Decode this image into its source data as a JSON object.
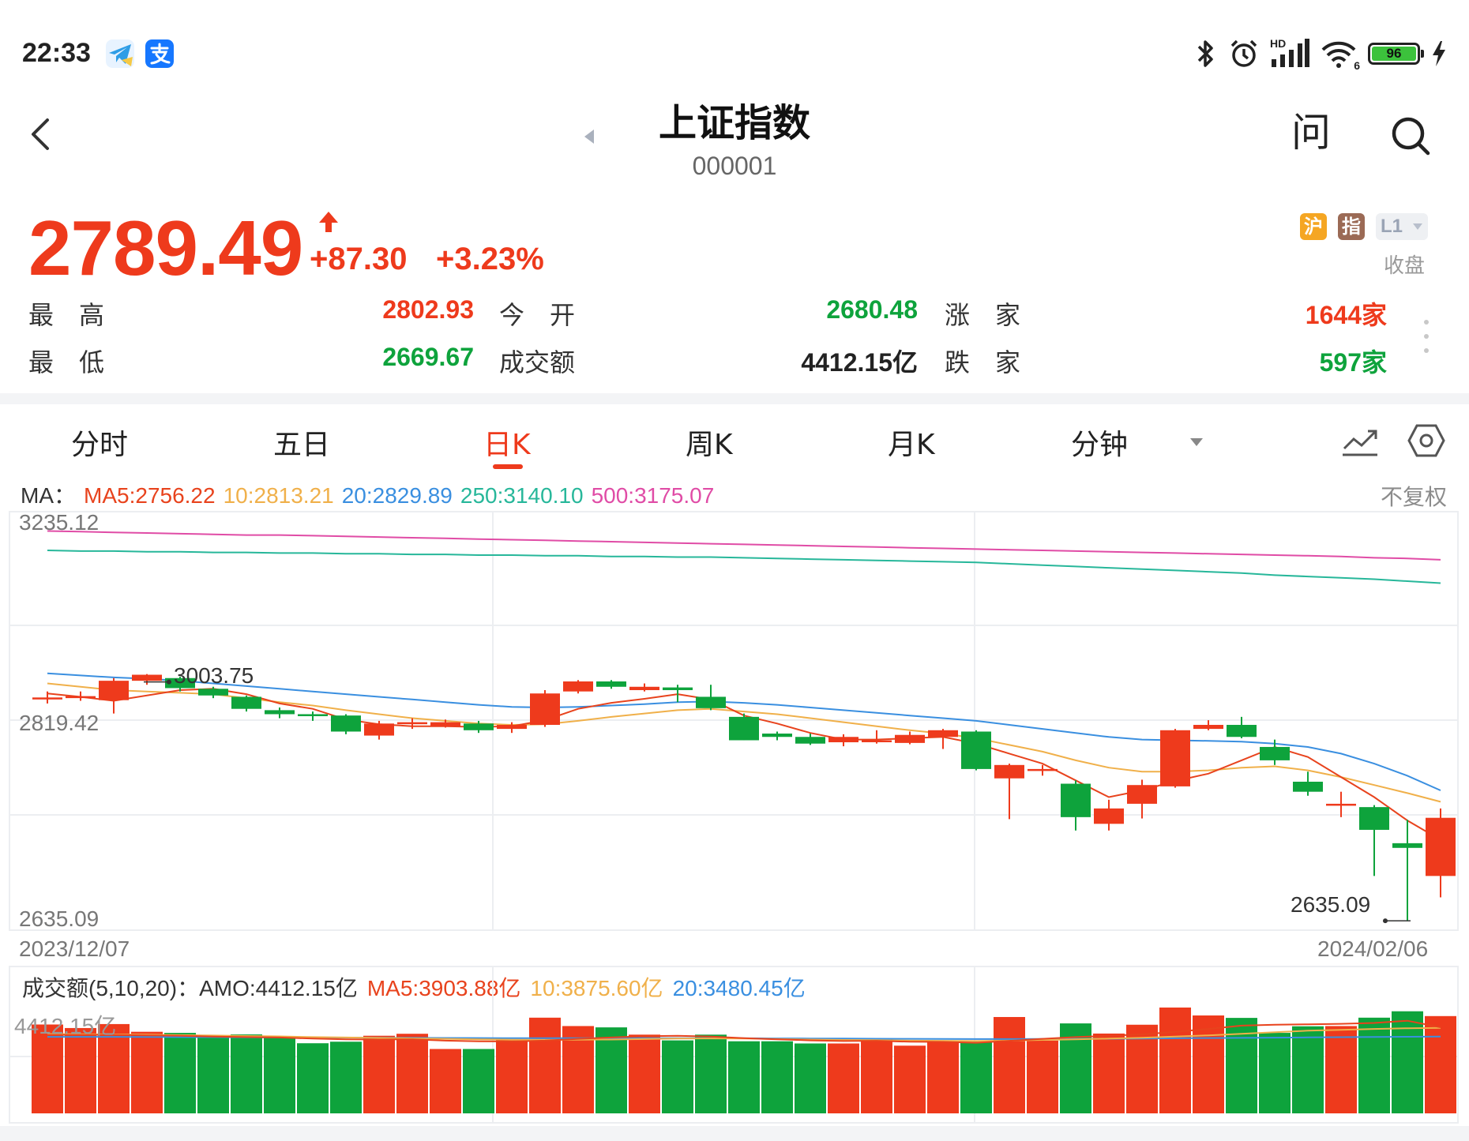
{
  "status_bar": {
    "time": "22:33",
    "network": "HD",
    "wifi_sub": "6",
    "battery": "96"
  },
  "header": {
    "title": "上证指数",
    "code": "000001",
    "ask_label": "问"
  },
  "quote": {
    "price": "2789.49",
    "change": "+87.30",
    "change_pct": "+3.23%",
    "badges": [
      "沪",
      "指",
      "L1"
    ],
    "status": "收盘",
    "colors": {
      "up": "#ee3a1c",
      "down": "#0ea33c"
    }
  },
  "stats": {
    "high_label": "最　高",
    "high": "2802.93",
    "open_label": "今　开",
    "open": "2680.48",
    "advance_label": "涨　家",
    "advance": "1644家",
    "low_label": "最　低",
    "low": "2669.67",
    "turnover_label": "成交额",
    "turnover": "4412.15亿",
    "decline_label": "跌　家",
    "decline": "597家"
  },
  "tabs": [
    {
      "label": "分时",
      "active": false
    },
    {
      "label": "五日",
      "active": false
    },
    {
      "label": "日K",
      "active": true
    },
    {
      "label": "周K",
      "active": false
    },
    {
      "label": "月K",
      "active": false
    },
    {
      "label": "分钟",
      "active": false
    }
  ],
  "ma_legend": {
    "prefix": "MA：",
    "ma5": "MA5:2756.22",
    "ma10": "10:2813.21",
    "ma20": "20:2829.89",
    "ma250": "250:3140.10",
    "ma500": "500:3175.07",
    "colors": {
      "ma5": "#e8431d",
      "ma10": "#f0b04a",
      "ma20": "#3a8fe0",
      "ma250": "#27b79a",
      "ma500": "#e04ca6"
    }
  },
  "adjust_label": "不复权",
  "chart_data": [
    {
      "type": "candlestick",
      "y_axis_labels": [
        "3235.12",
        "2819.42",
        "2635.09"
      ],
      "ylim": [
        2635.09,
        3235.12
      ],
      "x_start": "2023/12/07",
      "x_end": "2024/02/06",
      "annotations": {
        "high": "3003.75",
        "low": "2635.09"
      },
      "candles": [
        [
          2968,
          2969,
          2978,
          2960
        ],
        [
          2969,
          2971,
          2978,
          2964
        ],
        [
          2965,
          2994,
          2998,
          2945
        ],
        [
          2994,
          3003,
          3004,
          2988
        ],
        [
          2998,
          2983,
          3000,
          2978
        ],
        [
          2982,
          2972,
          2985,
          2968
        ],
        [
          2970,
          2952,
          2972,
          2948
        ],
        [
          2950,
          2944,
          2954,
          2938
        ],
        [
          2944,
          2942,
          2948,
          2934
        ],
        [
          2942,
          2918,
          2944,
          2914
        ],
        [
          2912,
          2930,
          2934,
          2906
        ],
        [
          2932,
          2932,
          2938,
          2922
        ],
        [
          2926,
          2932,
          2936,
          2924
        ],
        [
          2930,
          2920,
          2934,
          2916
        ],
        [
          2922,
          2928,
          2932,
          2916
        ],
        [
          2928,
          2975,
          2980,
          2925
        ],
        [
          2978,
          2993,
          2995,
          2975
        ],
        [
          2993,
          2985,
          2995,
          2982
        ],
        [
          2980,
          2985,
          2990,
          2978
        ],
        [
          2984,
          2980,
          2988,
          2962
        ],
        [
          2970,
          2953,
          2988,
          2950
        ],
        [
          2940,
          2905,
          2945,
          2905
        ],
        [
          2915,
          2910,
          2918,
          2905
        ],
        [
          2910,
          2900,
          2915,
          2898
        ],
        [
          2902,
          2910,
          2914,
          2896
        ],
        [
          2905,
          2905,
          2920,
          2900
        ],
        [
          2901,
          2913,
          2918,
          2899
        ],
        [
          2910,
          2920,
          2922,
          2892
        ],
        [
          2918,
          2862,
          2920,
          2860
        ],
        [
          2848,
          2868,
          2870,
          2787
        ],
        [
          2862,
          2862,
          2868,
          2852
        ],
        [
          2840,
          2790,
          2845,
          2770
        ],
        [
          2780,
          2803,
          2816,
          2770
        ],
        [
          2810,
          2838,
          2846,
          2788
        ],
        [
          2836,
          2920,
          2922,
          2834
        ],
        [
          2922,
          2928,
          2935,
          2920
        ],
        [
          2928,
          2910,
          2940,
          2908
        ],
        [
          2895,
          2875,
          2906,
          2868
        ],
        [
          2843,
          2828,
          2858,
          2822
        ],
        [
          2810,
          2810,
          2828,
          2790
        ],
        [
          2805,
          2771,
          2808,
          2702
        ],
        [
          2751,
          2744,
          2786,
          2635
        ],
        [
          2702,
          2789,
          2803,
          2670
        ]
      ],
      "ma5": [
        2975,
        2970,
        2964,
        2972,
        2980,
        2982,
        2974,
        2960,
        2952,
        2936,
        2929,
        2926,
        2926,
        2925,
        2926,
        2935,
        2952,
        2961,
        2967,
        2974,
        2966,
        2942,
        2930,
        2916,
        2906,
        2906,
        2908,
        2910,
        2900,
        2885,
        2870,
        2845,
        2820,
        2830,
        2844,
        2855,
        2875,
        2895,
        2880,
        2850,
        2820,
        2785,
        2756
      ],
      "ma10": [
        2990,
        2985,
        2980,
        2978,
        2976,
        2974,
        2968,
        2962,
        2957,
        2950,
        2944,
        2938,
        2934,
        2930,
        2928,
        2929,
        2934,
        2940,
        2945,
        2950,
        2952,
        2948,
        2944,
        2938,
        2932,
        2926,
        2920,
        2915,
        2908,
        2898,
        2888,
        2875,
        2864,
        2858,
        2858,
        2860,
        2864,
        2866,
        2860,
        2850,
        2838,
        2826,
        2813
      ],
      "ma20": [
        3005,
        3002,
        2999,
        2997,
        2994,
        2990,
        2986,
        2982,
        2978,
        2974,
        2970,
        2966,
        2962,
        2958,
        2955,
        2954,
        2955,
        2957,
        2959,
        2962,
        2963,
        2961,
        2958,
        2954,
        2950,
        2946,
        2942,
        2938,
        2934,
        2928,
        2922,
        2916,
        2910,
        2906,
        2905,
        2904,
        2903,
        2900,
        2895,
        2885,
        2870,
        2852,
        2830
      ],
      "ma250": [
        3189,
        3188,
        3188,
        3187,
        3187,
        3186,
        3186,
        3185,
        3185,
        3184,
        3184,
        3183,
        3183,
        3182,
        3182,
        3181,
        3181,
        3180,
        3180,
        3179,
        3179,
        3178,
        3177,
        3176,
        3175,
        3174,
        3173,
        3172,
        3171,
        3169,
        3167,
        3165,
        3163,
        3161,
        3159,
        3157,
        3155,
        3152,
        3150,
        3148,
        3146,
        3143,
        3140
      ],
      "ma500": [
        3218,
        3217,
        3216,
        3215,
        3214,
        3213,
        3212,
        3212,
        3211,
        3210,
        3209,
        3208,
        3207,
        3206,
        3205,
        3204,
        3203,
        3202,
        3201,
        3200,
        3199,
        3198,
        3197,
        3196,
        3195,
        3194,
        3193,
        3192,
        3191,
        3190,
        3189,
        3188,
        3187,
        3186,
        3185,
        3184,
        3183,
        3182,
        3181,
        3180,
        3178,
        3177,
        3175
      ]
    },
    {
      "type": "bar",
      "y_axis_label": "4412.15亿",
      "ylim": [
        0,
        4412.15
      ],
      "values": [
        4030,
        3870,
        4050,
        3700,
        3650,
        3500,
        3580,
        3430,
        3180,
        3250,
        3520,
        3610,
        2920,
        2920,
        3370,
        4340,
        3960,
        3900,
        3570,
        3310,
        3570,
        3270,
        3270,
        3170,
        3170,
        3350,
        3070,
        3230,
        3250,
        4370,
        3300,
        4080,
        3620,
        4020,
        4800,
        4440,
        4330,
        3650,
        3950,
        3960,
        4340,
        4630,
        4412
      ],
      "ma5": [
        3560,
        3560,
        3560,
        3540,
        3520,
        3480,
        3460,
        3440,
        3390,
        3360,
        3350,
        3360,
        3300,
        3270,
        3260,
        3300,
        3380,
        3440,
        3500,
        3520,
        3480,
        3410,
        3360,
        3310,
        3280,
        3290,
        3250,
        3240,
        3200,
        3290,
        3380,
        3460,
        3520,
        3580,
        3700,
        3830,
        3980,
        4020,
        4040,
        4060,
        4100,
        4200,
        3904
      ],
      "ma10": [
        3600,
        3590,
        3580,
        3570,
        3550,
        3530,
        3510,
        3490,
        3460,
        3440,
        3420,
        3400,
        3380,
        3360,
        3340,
        3330,
        3340,
        3350,
        3370,
        3390,
        3400,
        3390,
        3370,
        3350,
        3330,
        3320,
        3300,
        3290,
        3280,
        3300,
        3330,
        3360,
        3390,
        3430,
        3480,
        3540,
        3610,
        3680,
        3750,
        3790,
        3830,
        3860,
        3876
      ],
      "ma20": [
        3470,
        3470,
        3470,
        3465,
        3460,
        3455,
        3450,
        3445,
        3440,
        3435,
        3430,
        3425,
        3420,
        3415,
        3410,
        3410,
        3410,
        3410,
        3410,
        3410,
        3410,
        3405,
        3400,
        3395,
        3390,
        3385,
        3380,
        3375,
        3370,
        3370,
        3375,
        3380,
        3385,
        3395,
        3405,
        3415,
        3425,
        3435,
        3445,
        3455,
        3465,
        3475,
        3480
      ]
    }
  ],
  "volume_legend": {
    "prefix": "成交额(5,10,20)：AMO:4412.15亿",
    "ma5": "MA5:3903.88亿",
    "ma10": "10:3875.60亿",
    "ma20": "20:3480.45亿"
  }
}
